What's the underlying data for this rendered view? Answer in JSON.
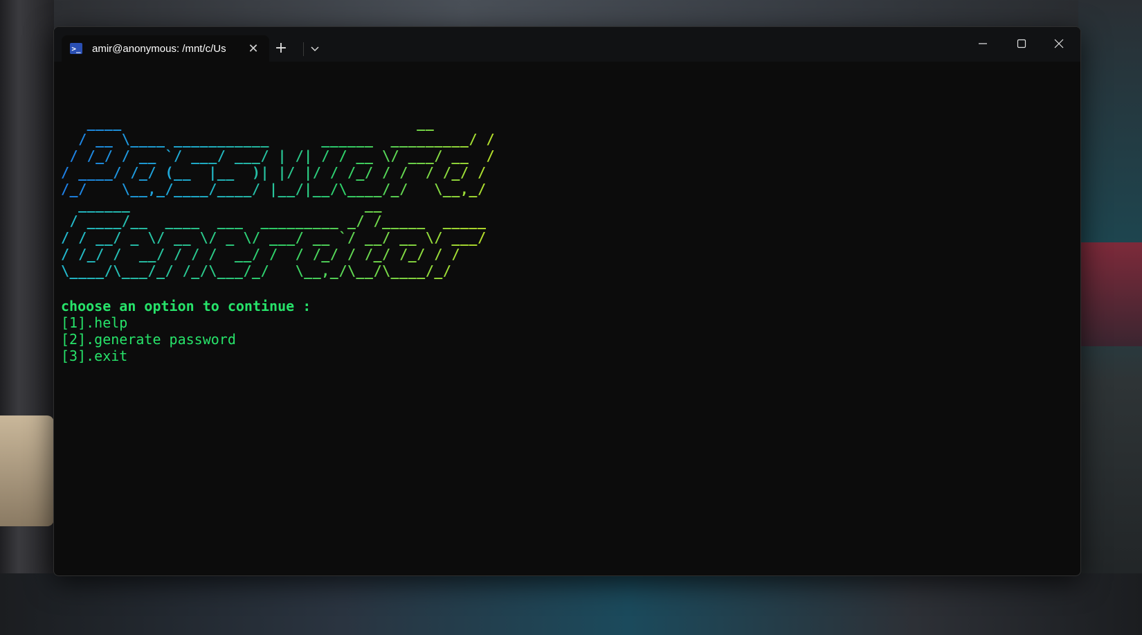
{
  "window": {
    "tab_title": "amir@anonymous: /mnt/c/Us",
    "tab_icon": "powershell-icon",
    "new_tab_label": "+",
    "controls": [
      "minimize-icon",
      "maximize-icon",
      "close-icon"
    ]
  },
  "terminal": {
    "ascii_password": "   ____                                  __\n  / __ \\____ ___________      ______  _________/ /\n / /_/ / __ `/ ___/ ___/ | /| / / __ \\/ ___/ __  /\n/ ____/ /_/ (__  |__  )| |/ |/ / /_/ / /  / /_/ /\n/_/    \\__,_/____/____/ |__/|__/\\____/_/   \\__,_/",
    "ascii_generator": "  ______                           __\n / ____/__  ____  ___  _________ _/ /_____  _____\n/ / __/ _ \\/ __ \\/ _ \\/ ___/ __ `/ __/ __ \\/ ___/\n/ /_/ /  __/ / / /  __/ /  / /_/ / /_/ /_/ / /\n\\____/\\___/_/ /_/\\___/_/   \\__,_/\\__/\\____/_/",
    "prompt": "choose an option to continue :",
    "options": [
      "[1].help",
      "[2].generate password",
      "[3].exit"
    ]
  },
  "colors": {
    "terminal_bg": "#0c0c0c",
    "text_green": "#27e36a",
    "gradient_blue": "#1e7fe8",
    "gradient_yellow": "#b8e02a"
  }
}
